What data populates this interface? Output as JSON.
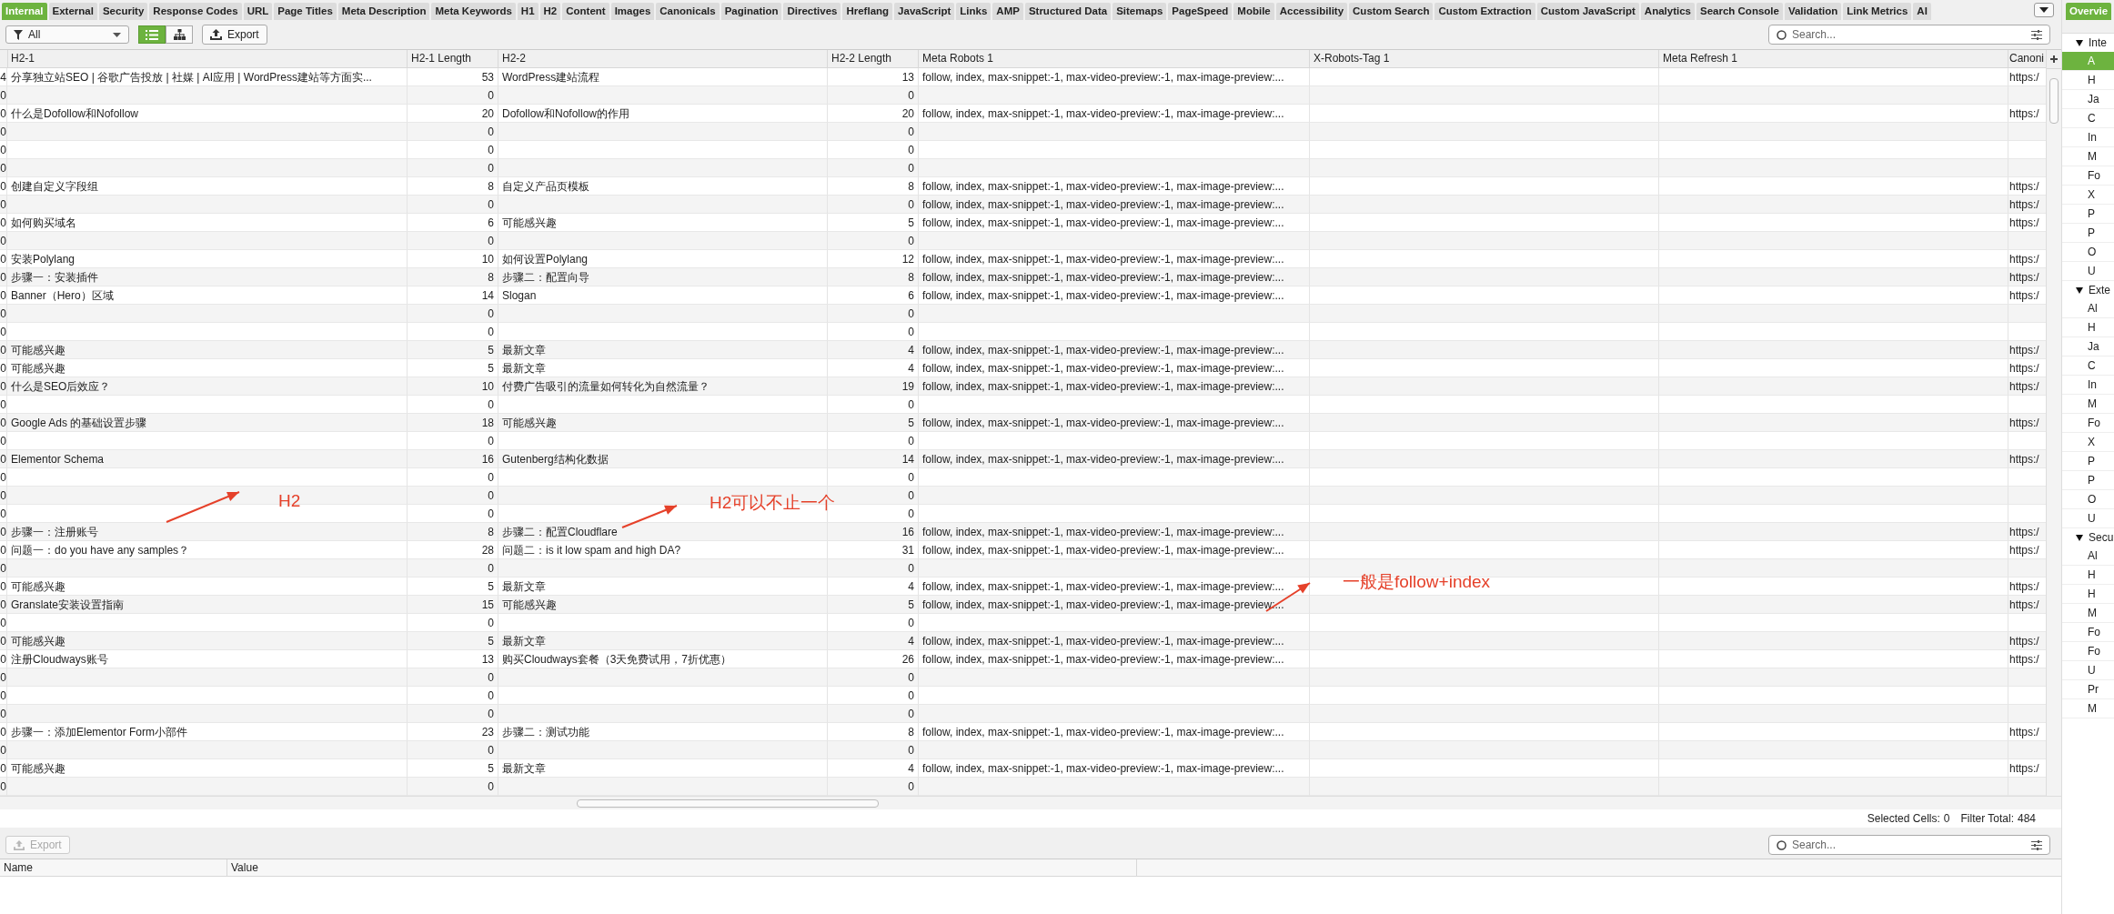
{
  "tabs": [
    {
      "label": "Internal",
      "selected": true
    },
    {
      "label": "External",
      "selected": false
    },
    {
      "label": "Security",
      "selected": false
    },
    {
      "label": "Response Codes",
      "selected": false
    },
    {
      "label": "URL",
      "selected": false
    },
    {
      "label": "Page Titles",
      "selected": false
    },
    {
      "label": "Meta Description",
      "selected": false
    },
    {
      "label": "Meta Keywords",
      "selected": false
    },
    {
      "label": "H1",
      "selected": false
    },
    {
      "label": "H2",
      "selected": false
    },
    {
      "label": "Content",
      "selected": false
    },
    {
      "label": "Images",
      "selected": false
    },
    {
      "label": "Canonicals",
      "selected": false
    },
    {
      "label": "Pagination",
      "selected": false
    },
    {
      "label": "Directives",
      "selected": false
    },
    {
      "label": "Hreflang",
      "selected": false
    },
    {
      "label": "JavaScript",
      "selected": false
    },
    {
      "label": "Links",
      "selected": false
    },
    {
      "label": "AMP",
      "selected": false
    },
    {
      "label": "Structured Data",
      "selected": false
    },
    {
      "label": "Sitemaps",
      "selected": false
    },
    {
      "label": "PageSpeed",
      "selected": false
    },
    {
      "label": "Mobile",
      "selected": false
    },
    {
      "label": "Accessibility",
      "selected": false
    },
    {
      "label": "Custom Search",
      "selected": false
    },
    {
      "label": "Custom Extraction",
      "selected": false
    },
    {
      "label": "Custom JavaScript",
      "selected": false
    },
    {
      "label": "Analytics",
      "selected": false
    },
    {
      "label": "Search Console",
      "selected": false
    },
    {
      "label": "Validation",
      "selected": false
    },
    {
      "label": "Link Metrics",
      "selected": false
    },
    {
      "label": "AI",
      "selected": false
    }
  ],
  "toolbar": {
    "filter": {
      "value": "All"
    },
    "view_buttons": [
      {
        "kind": "list",
        "selected": true
      },
      {
        "kind": "tree",
        "selected": false
      }
    ],
    "export_button": {
      "label": "Export",
      "disabled": false
    },
    "search": {
      "placeholder": "Search..."
    }
  },
  "table": {
    "columns": [
      "H2-1",
      "H2-1 Length",
      "H2-2",
      "H2-2 Length",
      "Meta Robots 1",
      "X-Robots-Tag 1",
      "Meta Refresh 1",
      "Canoni"
    ],
    "rows": [
      {
        "column_1": "4",
        "h2_1": "分享独立站SEO | 谷歌广告投放 | 社媒 | AI应用 | WordPress建站等方面实...",
        "h2_1_length": "53",
        "h2_2": "WordPress建站流程",
        "h2_2_length": "13",
        "meta_robots_1": "follow, index, max-snippet:-1, max-video-preview:-1, max-image-preview:...",
        "canonical": "https:/"
      },
      {
        "column_1": "0",
        "h2_1_length": "0",
        "h2_2_length": "0"
      },
      {
        "column_1": "0",
        "h2_1": "什么是Dofollow和Nofollow",
        "h2_1_length": "20",
        "h2_2": "Dofollow和Nofollow的作用",
        "h2_2_length": "20",
        "meta_robots_1": "follow, index, max-snippet:-1, max-video-preview:-1, max-image-preview:...",
        "canonical": "https:/"
      },
      {
        "column_1": "0",
        "h2_1_length": "0",
        "h2_2_length": "0"
      },
      {
        "column_1": "0",
        "h2_1_length": "0",
        "h2_2_length": "0"
      },
      {
        "column_1": "0",
        "h2_1_length": "0",
        "h2_2_length": "0"
      },
      {
        "column_1": "0",
        "h2_1": "创建自定义字段组",
        "h2_1_length": "8",
        "h2_2": "自定义产品页模板",
        "h2_2_length": "8",
        "meta_robots_1": "follow, index, max-snippet:-1, max-video-preview:-1, max-image-preview:...",
        "canonical": "https:/"
      },
      {
        "column_1": "0",
        "h2_1_length": "0",
        "h2_2_length": "0",
        "meta_robots_1": "follow, index, max-snippet:-1, max-video-preview:-1, max-image-preview:...",
        "canonical": "https:/"
      },
      {
        "column_1": "0",
        "h2_1": "如何购买域名",
        "h2_1_length": "6",
        "h2_2": "可能感兴趣",
        "h2_2_length": "5",
        "meta_robots_1": "follow, index, max-snippet:-1, max-video-preview:-1, max-image-preview:...",
        "canonical": "https:/"
      },
      {
        "column_1": "0",
        "h2_1_length": "0",
        "h2_2_length": "0"
      },
      {
        "column_1": "0",
        "h2_1": "安装Polylang",
        "h2_1_length": "10",
        "h2_2": "如何设置Polylang",
        "h2_2_length": "12",
        "meta_robots_1": "follow, index, max-snippet:-1, max-video-preview:-1, max-image-preview:...",
        "canonical": "https:/"
      },
      {
        "column_1": "0",
        "h2_1": "步骤一：安装插件",
        "h2_1_length": "8",
        "h2_2": "步骤二：配置向导",
        "h2_2_length": "8",
        "meta_robots_1": "follow, index, max-snippet:-1, max-video-preview:-1, max-image-preview:...",
        "canonical": "https:/"
      },
      {
        "column_1": "0",
        "h2_1": "Banner（Hero）区域",
        "h2_1_length": "14",
        "h2_2": "Slogan",
        "h2_2_length": "6",
        "meta_robots_1": "follow, index, max-snippet:-1, max-video-preview:-1, max-image-preview:...",
        "canonical": "https:/"
      },
      {
        "column_1": "0",
        "h2_1_length": "0",
        "h2_2_length": "0"
      },
      {
        "column_1": "0",
        "h2_1_length": "0",
        "h2_2_length": "0"
      },
      {
        "column_1": "0",
        "h2_1": "可能感兴趣",
        "h2_1_length": "5",
        "h2_2": "最新文章",
        "h2_2_length": "4",
        "meta_robots_1": "follow, index, max-snippet:-1, max-video-preview:-1, max-image-preview:...",
        "canonical": "https:/"
      },
      {
        "column_1": "0",
        "h2_1": "可能感兴趣",
        "h2_1_length": "5",
        "h2_2": "最新文章",
        "h2_2_length": "4",
        "meta_robots_1": "follow, index, max-snippet:-1, max-video-preview:-1, max-image-preview:...",
        "canonical": "https:/"
      },
      {
        "column_1": "0",
        "h2_1": "什么是SEO后效应？",
        "h2_1_length": "10",
        "h2_2": "付费广告吸引的流量如何转化为自然流量？",
        "h2_2_length": "19",
        "meta_robots_1": "follow, index, max-snippet:-1, max-video-preview:-1, max-image-preview:...",
        "canonical": "https:/"
      },
      {
        "column_1": "0",
        "h2_1_length": "0",
        "h2_2_length": "0"
      },
      {
        "column_1": "0",
        "h2_1": "Google Ads 的基础设置步骤",
        "h2_1_length": "18",
        "h2_2": "可能感兴趣",
        "h2_2_length": "5",
        "meta_robots_1": "follow, index, max-snippet:-1, max-video-preview:-1, max-image-preview:...",
        "canonical": "https:/"
      },
      {
        "column_1": "0",
        "h2_1_length": "0",
        "h2_2_length": "0"
      },
      {
        "column_1": "0",
        "h2_1": "Elementor Schema",
        "h2_1_length": "16",
        "h2_2": "Gutenberg结构化数据",
        "h2_2_length": "14",
        "meta_robots_1": "follow, index, max-snippet:-1, max-video-preview:-1, max-image-preview:...",
        "canonical": "https:/"
      },
      {
        "column_1": "0",
        "h2_1_length": "0",
        "h2_2_length": "0"
      },
      {
        "column_1": "0",
        "h2_1_length": "0",
        "h2_2_length": "0"
      },
      {
        "column_1": "0",
        "h2_1_length": "0",
        "h2_2_length": "0"
      },
      {
        "column_1": "0",
        "h2_1": "步骤一：注册账号",
        "h2_1_length": "8",
        "h2_2": "步骤二：配置Cloudflare",
        "h2_2_length": "16",
        "meta_robots_1": "follow, index, max-snippet:-1, max-video-preview:-1, max-image-preview:...",
        "canonical": "https:/"
      },
      {
        "column_1": "0",
        "h2_1": "问题一：do you have any samples？",
        "h2_1_length": "28",
        "h2_2": "问题二：is it low spam and high DA?",
        "h2_2_length": "31",
        "meta_robots_1": "follow, index, max-snippet:-1, max-video-preview:-1, max-image-preview:...",
        "canonical": "https:/"
      },
      {
        "column_1": "0",
        "h2_1_length": "0",
        "h2_2_length": "0"
      },
      {
        "column_1": "0",
        "h2_1": "可能感兴趣",
        "h2_1_length": "5",
        "h2_2": "最新文章",
        "h2_2_length": "4",
        "meta_robots_1": "follow, index, max-snippet:-1, max-video-preview:-1, max-image-preview:...",
        "canonical": "https:/"
      },
      {
        "column_1": "0",
        "h2_1": "Granslate安装设置指南",
        "h2_1_length": "15",
        "h2_2": "可能感兴趣",
        "h2_2_length": "5",
        "meta_robots_1": "follow, index, max-snippet:-1, max-video-preview:-1, max-image-preview:...",
        "canonical": "https:/"
      },
      {
        "column_1": "0",
        "h2_1_length": "0",
        "h2_2_length": "0"
      },
      {
        "column_1": "0",
        "h2_1": "可能感兴趣",
        "h2_1_length": "5",
        "h2_2": "最新文章",
        "h2_2_length": "4",
        "meta_robots_1": "follow, index, max-snippet:-1, max-video-preview:-1, max-image-preview:...",
        "canonical": "https:/"
      },
      {
        "column_1": "0",
        "h2_1": "注册Cloudways账号",
        "h2_1_length": "13",
        "h2_2": "购买Cloudways套餐（3天免费试用，7折优惠）",
        "h2_2_length": "26",
        "meta_robots_1": "follow, index, max-snippet:-1, max-video-preview:-1, max-image-preview:...",
        "canonical": "https:/"
      },
      {
        "column_1": "0",
        "h2_1_length": "0",
        "h2_2_length": "0"
      },
      {
        "column_1": "0",
        "h2_1_length": "0",
        "h2_2_length": "0"
      },
      {
        "column_1": "0",
        "h2_1_length": "0",
        "h2_2_length": "0"
      },
      {
        "column_1": "0",
        "h2_1": "步骤一：添加Elementor Form小部件",
        "h2_1_length": "23",
        "h2_2": "步骤二：测试功能",
        "h2_2_length": "8",
        "meta_robots_1": "follow, index, max-snippet:-1, max-video-preview:-1, max-image-preview:...",
        "canonical": "https:/"
      },
      {
        "column_1": "0",
        "h2_1_length": "0",
        "h2_2_length": "0"
      },
      {
        "column_1": "0",
        "h2_1": "可能感兴趣",
        "h2_1_length": "5",
        "h2_2": "最新文章",
        "h2_2_length": "4",
        "meta_robots_1": "follow, index, max-snippet:-1, max-video-preview:-1, max-image-preview:...",
        "canonical": "https:/"
      },
      {
        "column_1": "0",
        "h2_1_length": "0",
        "h2_2_length": "0"
      }
    ]
  },
  "status_bar": [
    {
      "label": "Selected Cells:",
      "value": "0"
    },
    {
      "label": "Filter Total:",
      "value": "484"
    }
  ],
  "bottom_pane": {
    "export_button": {
      "label": "Export",
      "disabled": true
    },
    "search": {
      "placeholder": "Search..."
    },
    "columns": [
      "Name",
      "Value"
    ]
  },
  "side_panel": {
    "tab": {
      "label": "Overvie",
      "selected": true
    },
    "sections": [
      {
        "label": "Inte",
        "expanded": true,
        "items": [
          {
            "label": "A",
            "selected": true
          },
          {
            "label": "H",
            "selected": false
          },
          {
            "label": "Ja",
            "selected": false
          },
          {
            "label": "C",
            "selected": false
          },
          {
            "label": "In",
            "selected": false
          },
          {
            "label": "M",
            "selected": false
          },
          {
            "label": "Fo",
            "selected": false
          },
          {
            "label": "X",
            "selected": false
          },
          {
            "label": "P",
            "selected": false
          },
          {
            "label": "P",
            "selected": false
          },
          {
            "label": "O",
            "selected": false
          },
          {
            "label": "U",
            "selected": false
          }
        ]
      },
      {
        "label": "Exte",
        "expanded": true,
        "items": [
          {
            "label": "Al",
            "selected": false
          },
          {
            "label": "H",
            "selected": false
          },
          {
            "label": "Ja",
            "selected": false
          },
          {
            "label": "C",
            "selected": false
          },
          {
            "label": "In",
            "selected": false
          },
          {
            "label": "M",
            "selected": false
          },
          {
            "label": "Fo",
            "selected": false
          },
          {
            "label": "X",
            "selected": false
          },
          {
            "label": "P",
            "selected": false
          },
          {
            "label": "P",
            "selected": false
          },
          {
            "label": "O",
            "selected": false
          },
          {
            "label": "U",
            "selected": false
          }
        ]
      },
      {
        "label": "Secu",
        "expanded": true,
        "items": [
          {
            "label": "Al",
            "selected": false
          },
          {
            "label": "H",
            "selected": false
          },
          {
            "label": "H",
            "selected": false
          },
          {
            "label": "M",
            "selected": false
          },
          {
            "label": "Fo",
            "selected": false
          },
          {
            "label": "Fo",
            "selected": false
          },
          {
            "label": "U",
            "selected": false
          },
          {
            "label": "Pr",
            "selected": false
          },
          {
            "label": "M",
            "selected": false
          }
        ]
      }
    ]
  },
  "annotations": [
    {
      "text": "H2"
    },
    {
      "text": "H2可以不止一个"
    },
    {
      "text": "一般是follow+index"
    }
  ]
}
